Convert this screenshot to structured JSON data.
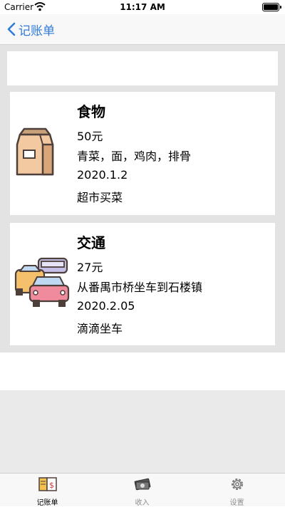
{
  "status_bar": {
    "carrier": "Carrier",
    "time": "11:17 AM"
  },
  "nav": {
    "back_label": "记账单"
  },
  "records": [
    {
      "title": "食物",
      "amount": "50元",
      "items": "青菜，面，鸡肉，排骨",
      "date": "2020.1.2",
      "note": "超市买菜",
      "icon": "food-bag-icon"
    },
    {
      "title": "交通",
      "amount": "27元",
      "items": "从番禺市桥坐车到石楼镇",
      "date": "2020.2.05",
      "note": "滴滴坐车",
      "icon": "cars-icon"
    }
  ],
  "tabs": [
    {
      "label": "记账单",
      "icon": "ledger-icon",
      "active": true
    },
    {
      "label": "收入",
      "icon": "money-icon",
      "active": false
    },
    {
      "label": "设置",
      "icon": "gear-icon",
      "active": false
    }
  ],
  "colors": {
    "accent": "#2f7bd6",
    "background": "#e3e3e3"
  }
}
